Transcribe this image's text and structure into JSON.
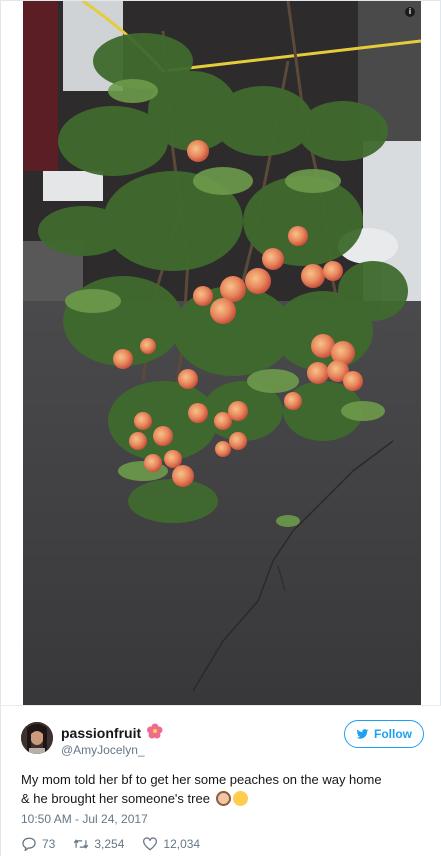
{
  "tweet": {
    "display_name": "passionfruit",
    "name_emoji_icon": "hibiscus-icon",
    "handle": "@AmyJocelyn_",
    "follow_label": "Follow",
    "text_line1": "My mom told her bf to get her some peaches on the way home",
    "text_line2": "& he brought her someone's tree",
    "timestamp": "10:50 AM - Jul 24, 2017",
    "replies": "73",
    "retweets": "3,254",
    "likes": "12,034"
  },
  "colors": {
    "twitter_blue": "#1da1f2",
    "secondary_text": "#657786",
    "primary_text": "#14171a"
  },
  "icons": [
    "info-icon",
    "twitter-bird-icon",
    "reply-icon",
    "retweet-icon",
    "like-icon"
  ]
}
